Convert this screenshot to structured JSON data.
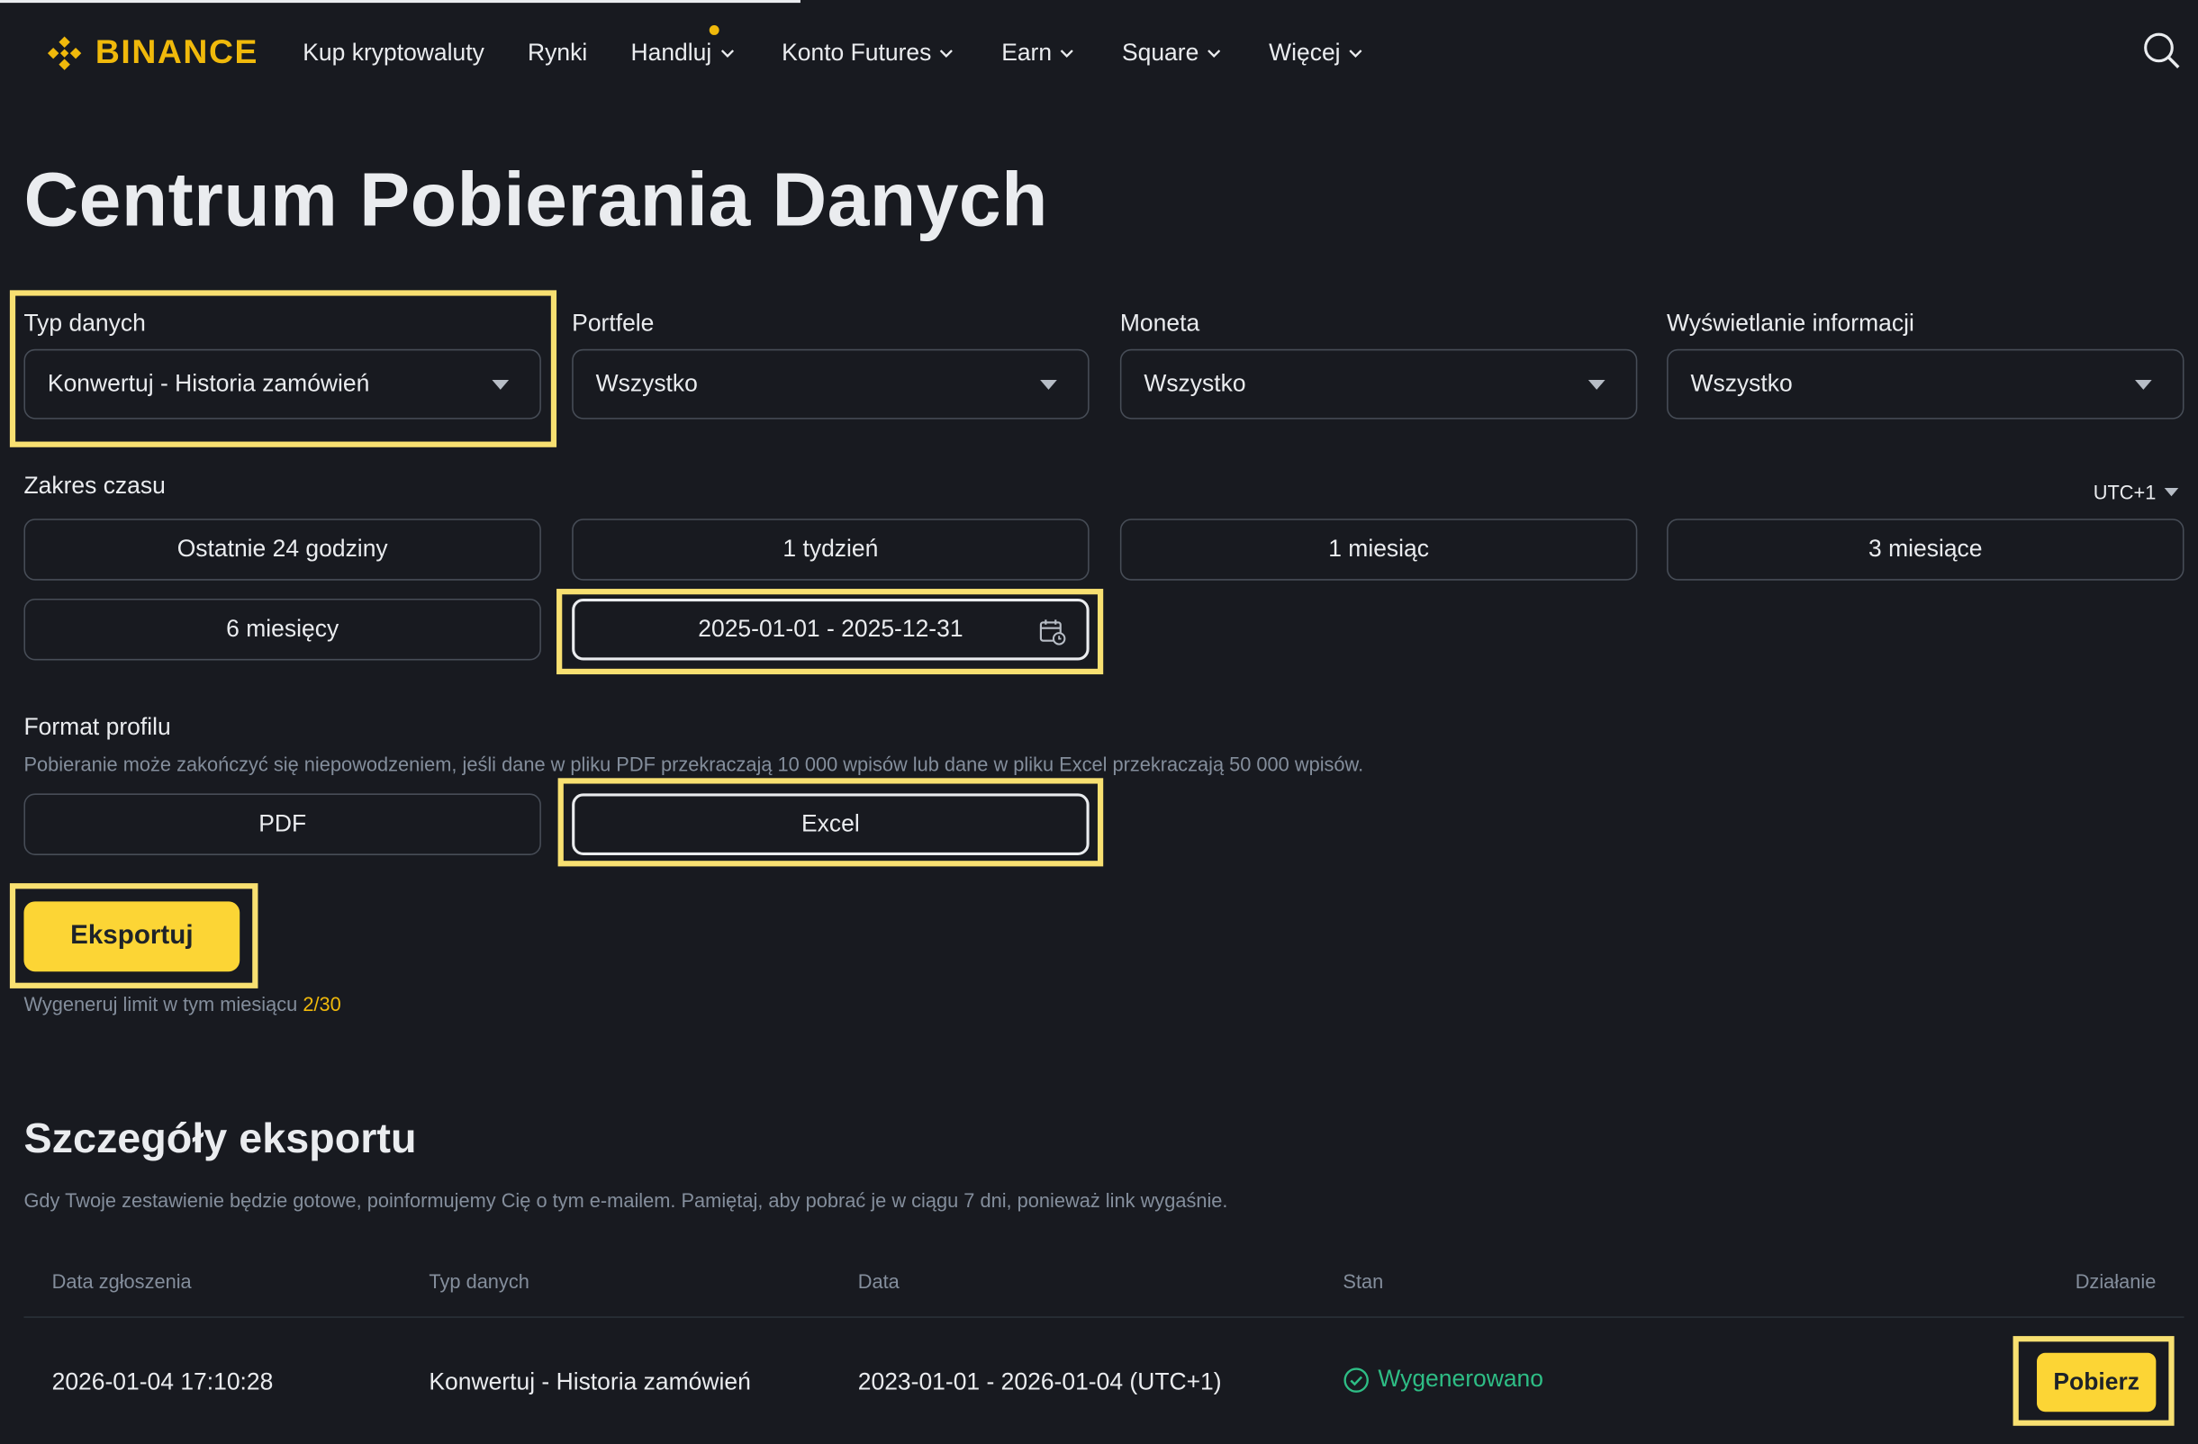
{
  "nav": {
    "logo_text": "BINANCE",
    "items": [
      {
        "label": "Kup kryptowaluty",
        "chevron": false,
        "dot": false
      },
      {
        "label": "Rynki",
        "chevron": false,
        "dot": false
      },
      {
        "label": "Handluj",
        "chevron": true,
        "dot": true
      },
      {
        "label": "Konto Futures",
        "chevron": true,
        "dot": false
      },
      {
        "label": "Earn",
        "chevron": true,
        "dot": false
      },
      {
        "label": "Square",
        "chevron": true,
        "dot": false
      },
      {
        "label": "Więcej",
        "chevron": true,
        "dot": false
      }
    ],
    "search_icon": "search-icon"
  },
  "page": {
    "title": "Centrum Pobierania Danych"
  },
  "filters": {
    "data_type": {
      "label": "Typ danych",
      "value": "Konwertuj - Historia zamówień"
    },
    "wallets": {
      "label": "Portfele",
      "value": "Wszystko"
    },
    "coin": {
      "label": "Moneta",
      "value": "Wszystko"
    },
    "display": {
      "label": "Wyświetlanie informacji",
      "value": "Wszystko"
    }
  },
  "time_range": {
    "label": "Zakres czasu",
    "timezone": "UTC+1",
    "options": [
      "Ostatnie 24 godziny",
      "1 tydzień",
      "1 miesiąc",
      "3 miesiące",
      "6 miesięcy"
    ],
    "custom_range": "2025-01-01 - 2025-12-31"
  },
  "format": {
    "label": "Format profilu",
    "hint": "Pobieranie może zakończyć się niepowodzeniem, jeśli dane w pliku PDF przekraczają 10 000 wpisów lub dane w pliku Excel przekraczają 50 000 wpisów.",
    "options": [
      "PDF",
      "Excel"
    ],
    "selected": "Excel"
  },
  "export": {
    "button": "Eksportuj",
    "limit_text": "Wygeneruj limit w tym miesiącu ",
    "limit_value": "2/30"
  },
  "details": {
    "title": "Szczegóły eksportu",
    "note": "Gdy Twoje zestawienie będzie gotowe, poinformujemy Cię o tym e-mailem. Pamiętaj, aby pobrać je w ciągu 7 dni, ponieważ link wygaśnie.",
    "columns": [
      "Data zgłoszenia",
      "Typ danych",
      "Data",
      "Stan",
      "Działanie"
    ],
    "rows": [
      {
        "submitted": "2026-01-04 17:10:28",
        "type": "Konwertuj - Historia zamówień",
        "range": "2023-01-01 - 2026-01-04 (UTC+1)",
        "status": "Wygenerowano",
        "action": "Pobierz"
      }
    ]
  },
  "colors": {
    "background": "#181a20",
    "brand": "#f0b90b",
    "button": "#fcd535",
    "success": "#2ebd85",
    "highlight": "#f8e071"
  }
}
